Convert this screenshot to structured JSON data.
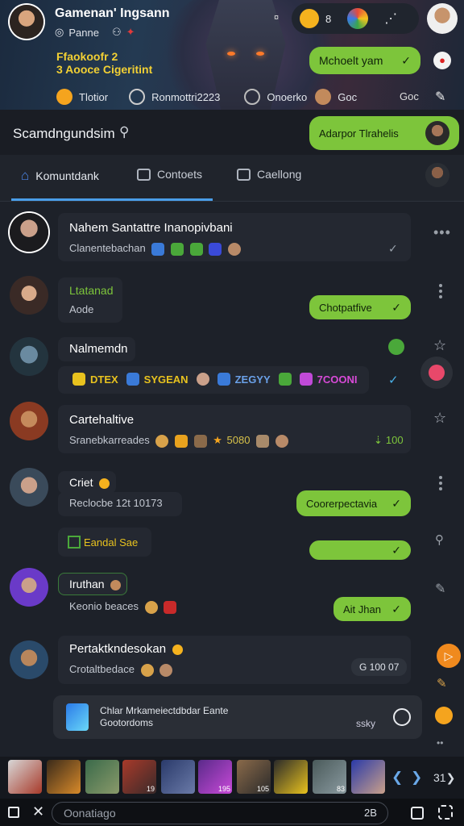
{
  "banner": {
    "title": "Gamenan' Ingsann",
    "subtitle": "Panne",
    "headline_line1": "Ffaokoofr 2",
    "headline_line2": "3 Aooce Cigeritint",
    "reply_bubble": "Mchoelt yam",
    "top_count": "8",
    "stats": [
      {
        "label": "Tlotior"
      },
      {
        "label": "Ronmottri2223"
      },
      {
        "label": "Onoerko"
      },
      {
        "label": "Goc"
      }
    ],
    "stat_right": "Goc"
  },
  "topbar": {
    "title": "Scamdngundsim",
    "action_label": "Adarpor Tlrahelis"
  },
  "tabs": [
    {
      "label": "Komuntdank",
      "icon": "home-icon",
      "active": true
    },
    {
      "label": "Contoets",
      "icon": "chat-icon",
      "active": false
    },
    {
      "label": "Caellong",
      "icon": "calendar-icon",
      "active": false
    }
  ],
  "messages": [
    {
      "name": "Nahem Santattre Inanopivbani",
      "sub": "Clanentebachan",
      "bubble": "",
      "check": "✓"
    },
    {
      "name": "Ltatanad",
      "sub": "Aode",
      "bubble": "Chotpatfive",
      "check": "✓"
    },
    {
      "name": "Nalmemdn",
      "sub": "",
      "tags": [
        "DTEX",
        "SYGEAN",
        "ZEGYY",
        "7COONI"
      ],
      "check": "✓"
    },
    {
      "name": "Cartehaltive",
      "sub": "Sranebkarreades",
      "extra": "5080",
      "right": "100"
    },
    {
      "name": "Criet",
      "sub": "Reclocbe  12t  10173",
      "bubble": "Coorerpectavia",
      "check": "✓"
    },
    {
      "name": "",
      "sub": "Eandal Sae",
      "bubble": "",
      "check": "✓"
    },
    {
      "name": "Iruthan",
      "sub": "Keonio beaces",
      "bubble": "Ait Jhan",
      "check": "✓"
    },
    {
      "name": "Pertaktkndesokan",
      "sub": "Crotaltbedace",
      "right": "G 100 07"
    }
  ],
  "composer": {
    "line1": "Chlar Mrkameiectdbdar Eante",
    "line2": "Gootordoms",
    "right": "ssky"
  },
  "bottom": {
    "input_placeholder": "Oonatiago",
    "counter": "2B"
  },
  "thumb_labels": [
    "",
    "",
    "",
    "19",
    "",
    "195",
    "105",
    "",
    "83",
    ""
  ],
  "nav": {
    "prev": "❮",
    "next": "❮",
    "more": "31❯"
  },
  "colors": {
    "accent": "#7dc53b",
    "bg": "#1d2129",
    "orange": "#f08a1e"
  }
}
